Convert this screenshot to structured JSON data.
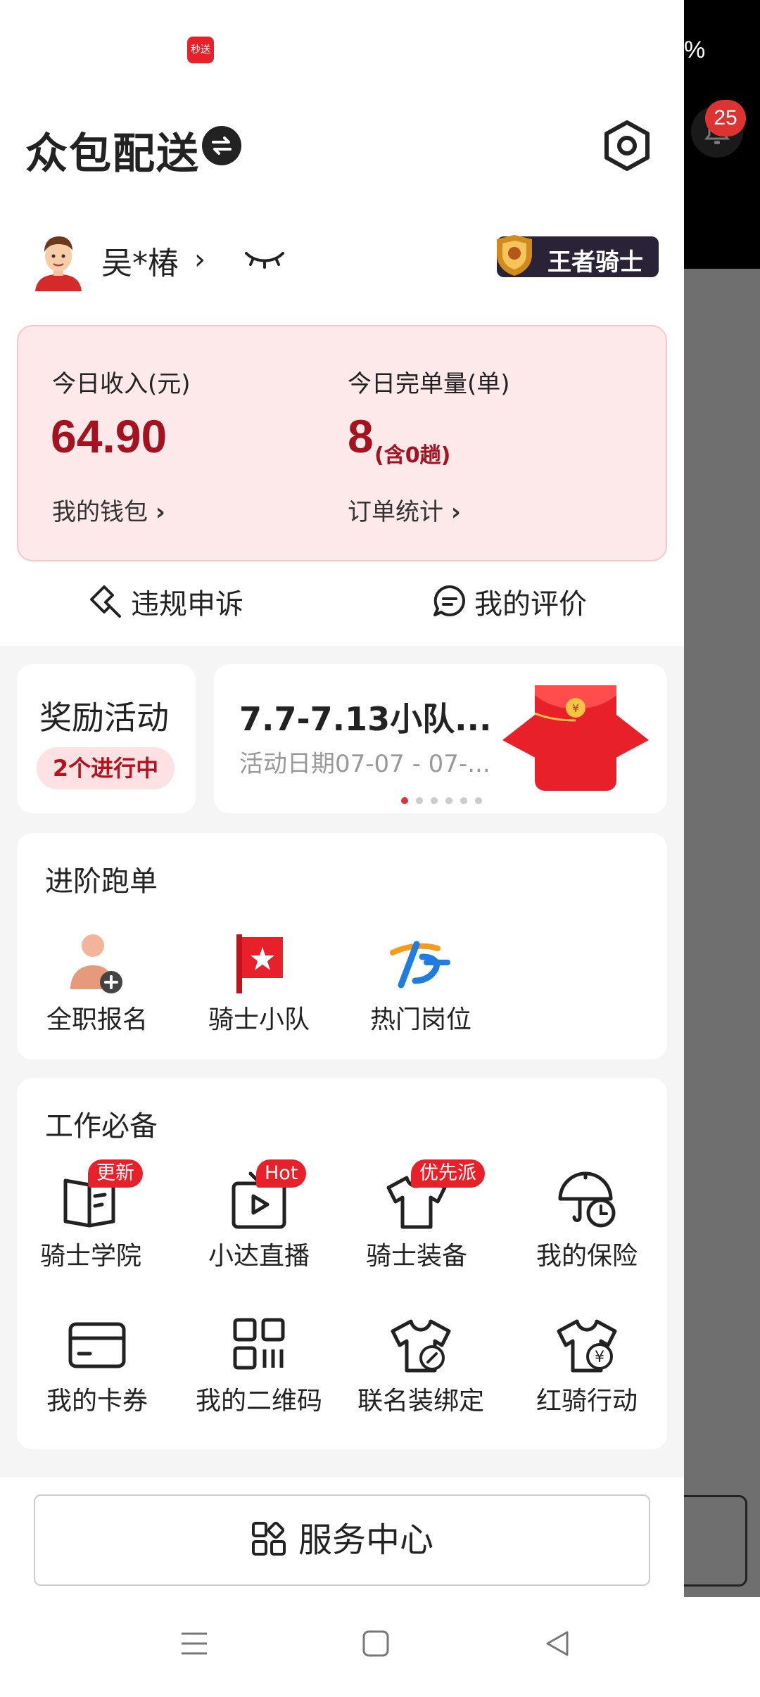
{
  "status": {
    "app_icon_text": "秒送",
    "background_percent": "%",
    "notification_count": "25"
  },
  "header": {
    "title": "众包配送"
  },
  "user": {
    "name": "吴*椿",
    "chevron": "›",
    "rank_badge": "王者骑士"
  },
  "stats": {
    "income_label": "今日收入(元)",
    "income_value": "64.90",
    "wallet_link": "我的钱包",
    "orders_label": "今日完单量(单)",
    "orders_value": "8",
    "orders_sub": "(含0趟)",
    "orders_link": "订单统计",
    "link_arrow": "›"
  },
  "actions": {
    "appeal": "违规申诉",
    "review": "我的评价"
  },
  "reward": {
    "title": "奖励活动",
    "pill": "2个进行中"
  },
  "banner": {
    "title": "7.7-7.13小队...",
    "date": "活动日期07-07 - 07-..."
  },
  "advanced": {
    "title": "进阶跑单",
    "items": [
      {
        "label": "全职报名",
        "icon": "person-add-icon"
      },
      {
        "label": "骑士小队",
        "icon": "flag-icon"
      },
      {
        "label": "热门岗位",
        "icon": "jobs-logo-icon"
      }
    ]
  },
  "work": {
    "title": "工作必备",
    "items": [
      {
        "label": "骑士学院",
        "tag": "更新",
        "icon": "book-icon"
      },
      {
        "label": "小达直播",
        "tag": "Hot",
        "icon": "tv-play-icon"
      },
      {
        "label": "骑士装备",
        "tag": "优先派",
        "icon": "shirt-icon"
      },
      {
        "label": "我的保险",
        "tag": "",
        "icon": "umbrella-clock-icon"
      },
      {
        "label": "我的卡券",
        "tag": "",
        "icon": "card-icon"
      },
      {
        "label": "我的二维码",
        "tag": "",
        "icon": "qrcode-icon"
      },
      {
        "label": "联名装绑定",
        "tag": "",
        "icon": "shirt-link-icon"
      },
      {
        "label": "红骑行动",
        "tag": "",
        "icon": "shirt-yen-icon"
      }
    ]
  },
  "service": {
    "label": "服务中心"
  },
  "colors": {
    "brand_red": "#e8202a",
    "value_red": "#a3121e",
    "card_pink": "#fde8ea"
  }
}
